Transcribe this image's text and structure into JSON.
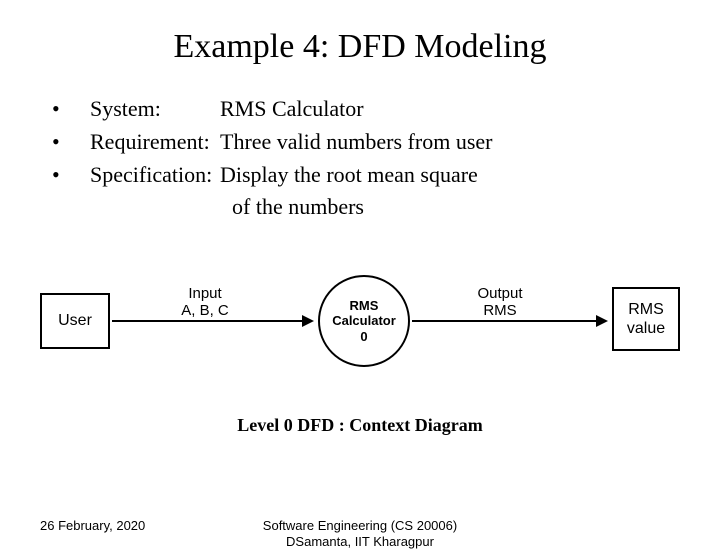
{
  "title": "Example 4: DFD Modeling",
  "bullets": {
    "sys_label": "System:",
    "sys_value": "RMS Calculator",
    "req_label": "Requirement:",
    "req_value": "Three valid numbers from user",
    "spec_label": "Specification:",
    "spec_value": "Display the root mean square",
    "spec_cont": "of the numbers"
  },
  "diagram": {
    "source": "User",
    "input_label_1": "Input",
    "input_label_2": "A, B, C",
    "process_1": "RMS",
    "process_2": "Calculator",
    "process_3": "0",
    "output_label_1": "Output",
    "output_label_2": "RMS",
    "sink_1": "RMS",
    "sink_2": "value"
  },
  "caption": "Level 0 DFD : Context Diagram",
  "footer": {
    "date": "26 February, 2020",
    "course": "Software Engineering (CS 20006)",
    "author": "DSamanta, IIT Kharagpur"
  }
}
